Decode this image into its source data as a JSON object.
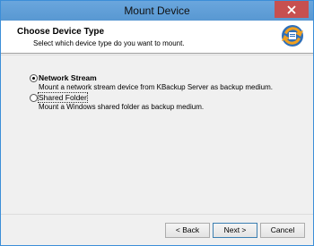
{
  "window": {
    "title": "Mount Device",
    "close_label": "✕"
  },
  "header": {
    "title": "Choose Device Type",
    "subtitle": "Select which device type do you want to mount.",
    "logo_icon": "kbackup-logo-icon"
  },
  "options": [
    {
      "label": "Network Stream",
      "description": "Mount a network stream device from KBackup Server as backup medium.",
      "selected": true
    },
    {
      "label": "Shared Folder",
      "description": "Mount a Windows shared folder as backup medium.",
      "selected": false
    }
  ],
  "buttons": {
    "back": "< Back",
    "next": "Next >",
    "cancel": "Cancel"
  },
  "colors": {
    "titlebar": "#5898d2",
    "close": "#c75050",
    "accent": "#3c7fb1"
  }
}
